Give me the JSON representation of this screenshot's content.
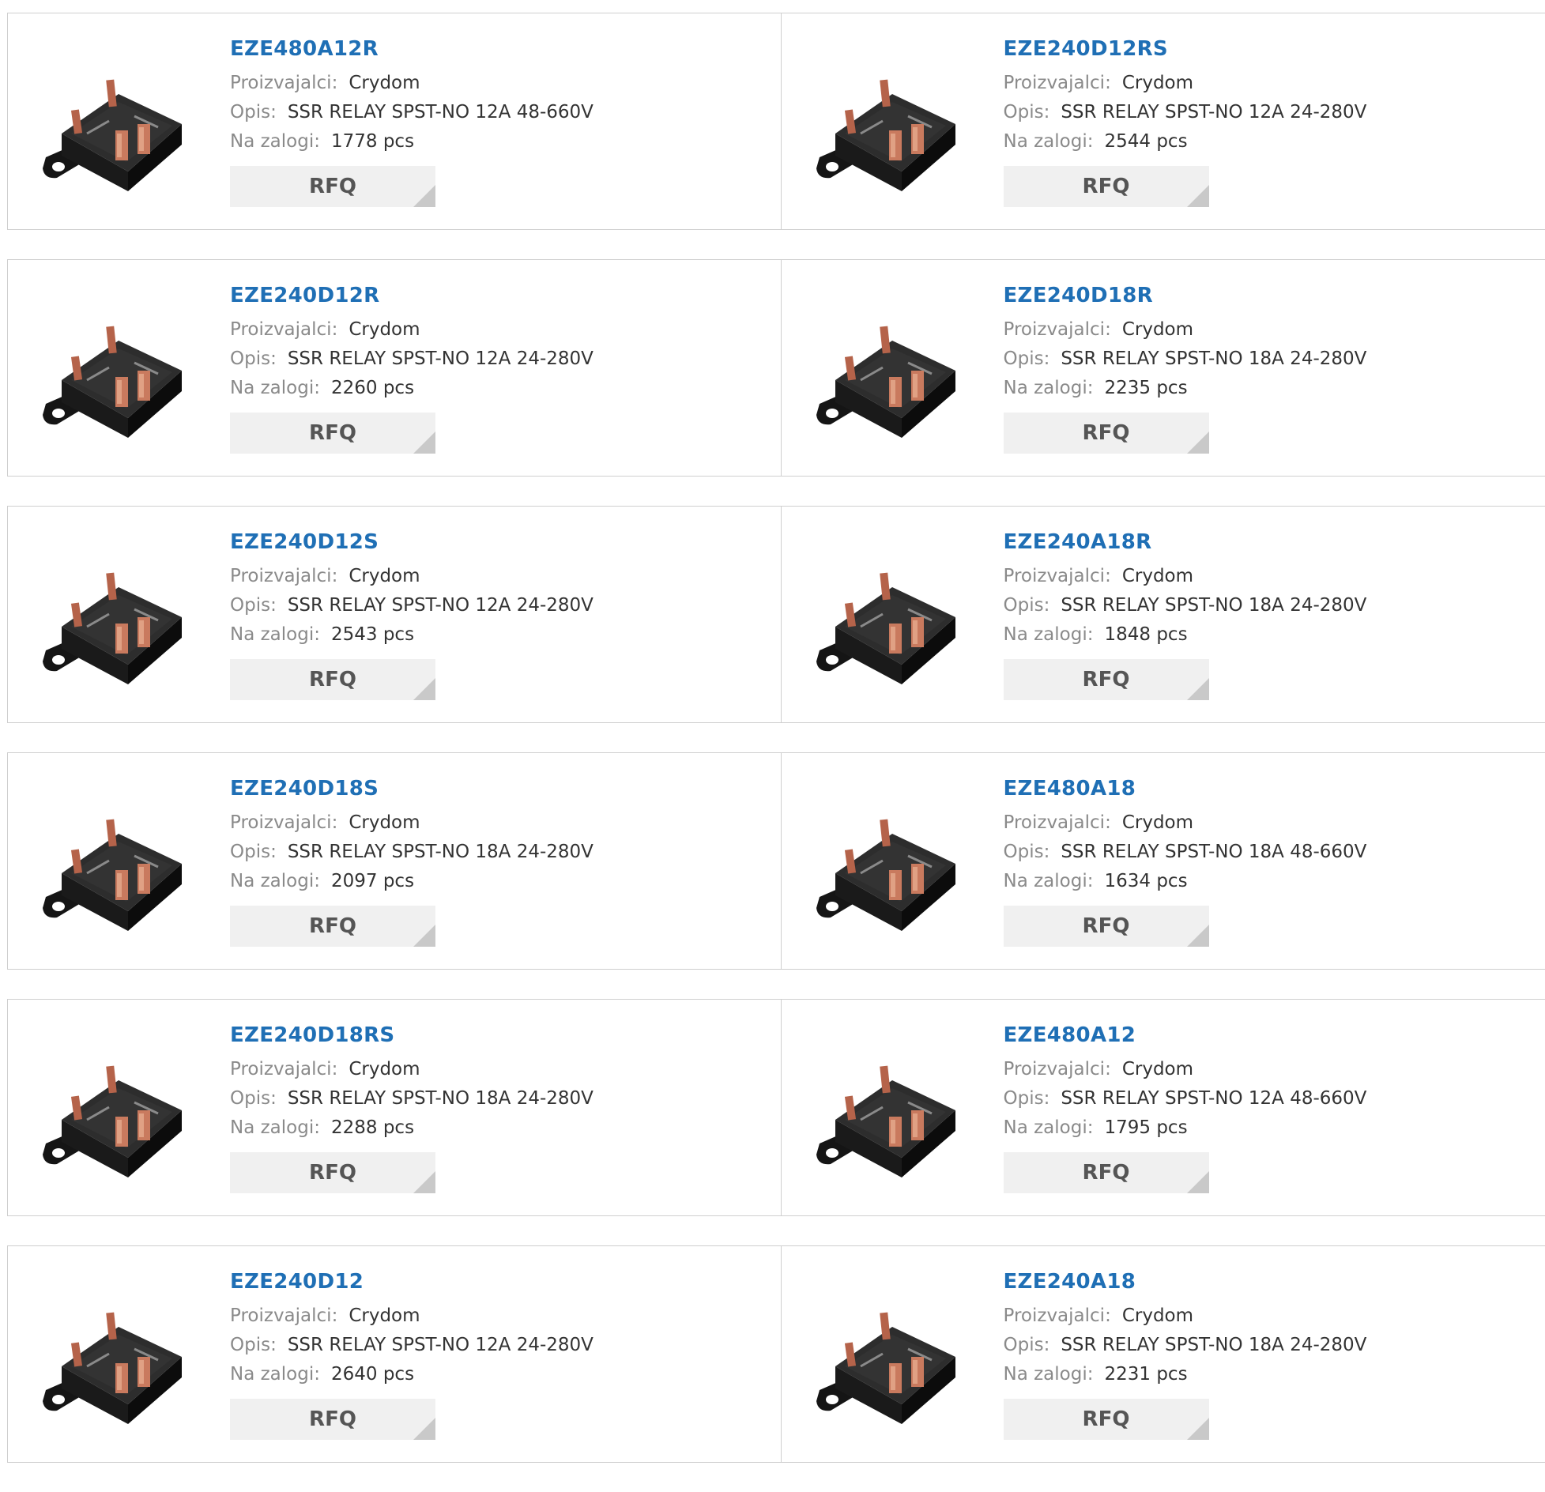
{
  "labels": {
    "manufacturer": "Proizvajalci:",
    "description": "Opis:",
    "stock": "Na zalogi:",
    "rfq": "RFQ"
  },
  "products": [
    {
      "pn": "EZE480A12R",
      "manufacturer": "Crydom",
      "description": "SSR RELAY SPST-NO 12A 48-660V",
      "stock": "1778 pcs"
    },
    {
      "pn": "EZE240D12RS",
      "manufacturer": "Crydom",
      "description": "SSR RELAY SPST-NO 12A 24-280V",
      "stock": "2544 pcs"
    },
    {
      "pn": "EZE240D12R",
      "manufacturer": "Crydom",
      "description": "SSR RELAY SPST-NO 12A 24-280V",
      "stock": "2260 pcs"
    },
    {
      "pn": "EZE240D18R",
      "manufacturer": "Crydom",
      "description": "SSR RELAY SPST-NO 18A 24-280V",
      "stock": "2235 pcs"
    },
    {
      "pn": "EZE240D12S",
      "manufacturer": "Crydom",
      "description": "SSR RELAY SPST-NO 12A 24-280V",
      "stock": "2543 pcs"
    },
    {
      "pn": "EZE240A18R",
      "manufacturer": "Crydom",
      "description": "SSR RELAY SPST-NO 18A 24-280V",
      "stock": "1848 pcs"
    },
    {
      "pn": "EZE240D18S",
      "manufacturer": "Crydom",
      "description": "SSR RELAY SPST-NO 18A 24-280V",
      "stock": "2097 pcs"
    },
    {
      "pn": "EZE480A18",
      "manufacturer": "Crydom",
      "description": "SSR RELAY SPST-NO 18A 48-660V",
      "stock": "1634 pcs"
    },
    {
      "pn": "EZE240D18RS",
      "manufacturer": "Crydom",
      "description": "SSR RELAY SPST-NO 18A 24-280V",
      "stock": "2288 pcs"
    },
    {
      "pn": "EZE480A12",
      "manufacturer": "Crydom",
      "description": "SSR RELAY SPST-NO 12A 48-660V",
      "stock": "1795 pcs"
    },
    {
      "pn": "EZE240D12",
      "manufacturer": "Crydom",
      "description": "SSR RELAY SPST-NO 12A 24-280V",
      "stock": "2640 pcs"
    },
    {
      "pn": "EZE240A18",
      "manufacturer": "Crydom",
      "description": "SSR RELAY SPST-NO 18A 24-280V",
      "stock": "2231 pcs"
    }
  ],
  "colors": {
    "link": "#1f6fb5",
    "border": "#cfcfcf",
    "button_bg": "#f0f0f0"
  }
}
